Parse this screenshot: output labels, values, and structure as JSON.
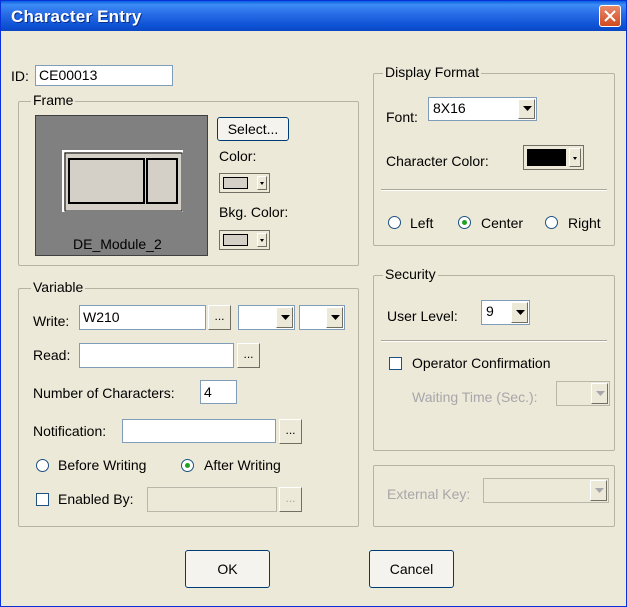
{
  "window": {
    "title": "Character Entry"
  },
  "id_field": {
    "label": "ID:",
    "value": "CE00013"
  },
  "frame": {
    "group_label": "Frame",
    "preview_name": "DE_Module_2",
    "select_label": "Select...",
    "color_label": "Color:",
    "bkg_color_label": "Bkg. Color:",
    "color_value": "#d4d0c8",
    "bkg_color_value": "#d4d0c8"
  },
  "display_format": {
    "group_label": "Display Format",
    "font_label": "Font:",
    "font_value": "8X16",
    "char_color_label": "Character Color:",
    "char_color_value": "#000000",
    "alignment": {
      "left": "Left",
      "center": "Center",
      "right": "Right",
      "selected": "Center"
    }
  },
  "variable": {
    "group_label": "Variable",
    "write_label": "Write:",
    "write_value": "W210",
    "read_label": "Read:",
    "read_value": "",
    "num_chars_label": "Number of Characters:",
    "num_chars_value": "4",
    "notification_label": "Notification:",
    "notification_value": "",
    "before_writing": "Before Writing",
    "after_writing": "After Writing",
    "timing_selected": "After Writing",
    "enabled_by_label": "Enabled By:",
    "enabled_by_value": "",
    "browse_label": "..."
  },
  "security": {
    "group_label": "Security",
    "user_level_label": "User Level:",
    "user_level_value": "9",
    "operator_confirmation_label": "Operator Confirmation",
    "waiting_time_label": "Waiting Time (Sec.):",
    "waiting_time_value": ""
  },
  "external_key": {
    "label": "External Key:",
    "value": ""
  },
  "buttons": {
    "ok": "OK",
    "cancel": "Cancel"
  },
  "colors": {
    "titlebar": "#0a5fe0",
    "dialog_bg": "#ece9d8",
    "radio_dot": "#21a121"
  }
}
